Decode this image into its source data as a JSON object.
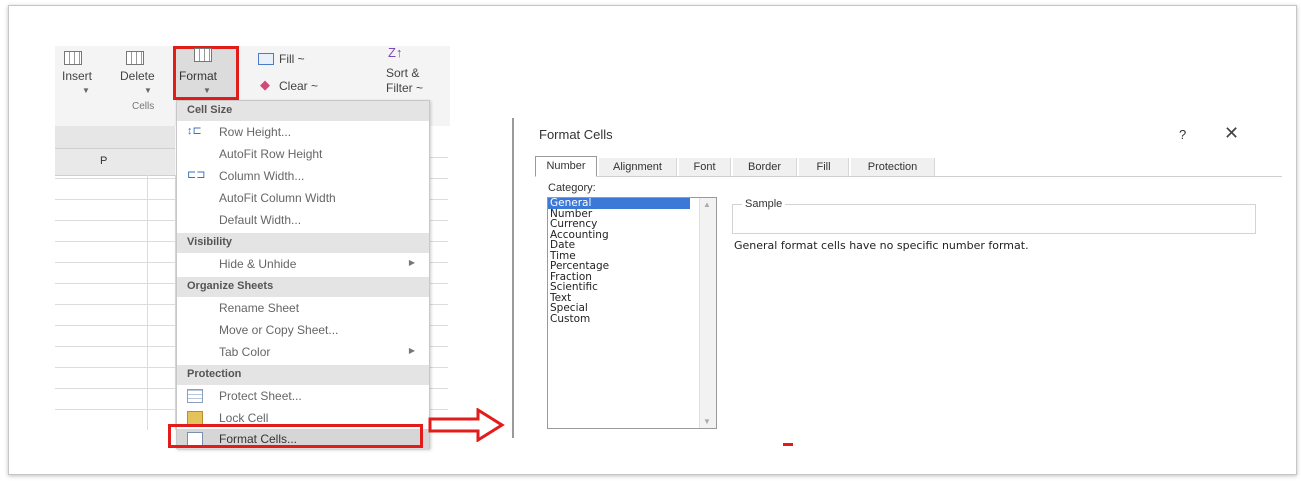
{
  "ribbon": {
    "insert_label": "Insert",
    "delete_label": "Delete",
    "format_label": "Format",
    "fill_label": "Fill ~",
    "clear_label": "Clear ~",
    "sort_label_1": "Sort &",
    "sort_label_2": "Filter ~",
    "group_cells": "Cells"
  },
  "sheet": {
    "column_header": "P"
  },
  "menu": {
    "sections": {
      "cell_size": "Cell Size",
      "visibility": "Visibility",
      "organize": "Organize Sheets",
      "protection": "Protection"
    },
    "items": {
      "row_height": "Row Height...",
      "autofit_row": "AutoFit Row Height",
      "column_width": "Column Width...",
      "autofit_col": "AutoFit Column Width",
      "default_width": "Default Width...",
      "hide_unhide": "Hide & Unhide",
      "rename_sheet": "Rename Sheet",
      "move_copy": "Move or Copy Sheet...",
      "tab_color": "Tab Color",
      "protect_sheet": "Protect Sheet...",
      "lock_cell": "Lock Cell",
      "format_cells": "Format Cells..."
    }
  },
  "dialog": {
    "title": "Format Cells",
    "help": "?",
    "close": "✕",
    "tabs": [
      "Number",
      "Alignment",
      "Font",
      "Border",
      "Fill",
      "Protection"
    ],
    "category_label": "Category:",
    "categories": [
      "General",
      "Number",
      "Currency",
      "Accounting",
      "Date",
      "Time",
      "Percentage",
      "Fraction",
      "Scientific",
      "Text",
      "Special",
      "Custom"
    ],
    "selected_category": "General",
    "sample_label": "Sample",
    "description": "General format cells have no specific number format."
  },
  "colors": {
    "highlight_red": "#e21b1b",
    "selection_blue": "#3c78d8"
  }
}
